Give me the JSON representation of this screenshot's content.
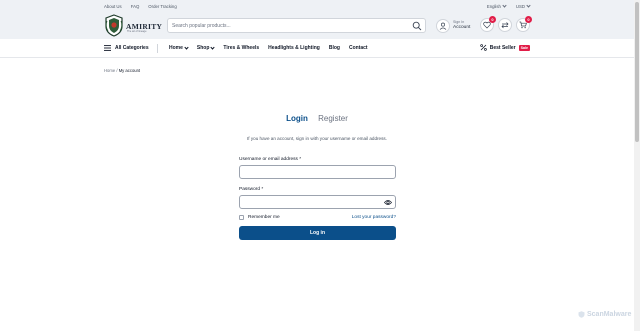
{
  "topbar": {
    "links": [
      "About Us",
      "FAQ",
      "Order Tracking"
    ],
    "language": "English",
    "currency": "USD"
  },
  "header": {
    "brand": "AMIRITY",
    "tagline": "The art of lineage",
    "search_placeholder": "Search popular products...",
    "account_top": "Sign In",
    "account_bottom": "Account",
    "wishlist_count": "0",
    "compare_count": "",
    "cart_count": "0"
  },
  "nav": {
    "all_categories": "All Categories",
    "items": [
      {
        "label": "Home",
        "dropdown": true
      },
      {
        "label": "Shop",
        "dropdown": true
      },
      {
        "label": "Tires & Wheels",
        "dropdown": false
      },
      {
        "label": "Headlights & Lighting",
        "dropdown": false
      },
      {
        "label": "Blog",
        "dropdown": false
      },
      {
        "label": "Contact",
        "dropdown": false
      }
    ],
    "best_seller": "Best Seller",
    "sale_badge": "Sale"
  },
  "breadcrumb": {
    "home": "Home",
    "separator": "/",
    "current": "My account"
  },
  "auth": {
    "tab_login": "Login",
    "tab_register": "Register",
    "intro": "If you have an account, sign in with your username or email address.",
    "username_label": "Username or email address *",
    "password_label": "Password *",
    "remember_label": "Remember me",
    "lost_password": "Lost your password?",
    "submit_label": "Log in"
  },
  "watermark": "ScanMalware",
  "colors": {
    "accent": "#0b4f8a",
    "badge": "#e11d48",
    "header_bg": "#eef1f5"
  }
}
